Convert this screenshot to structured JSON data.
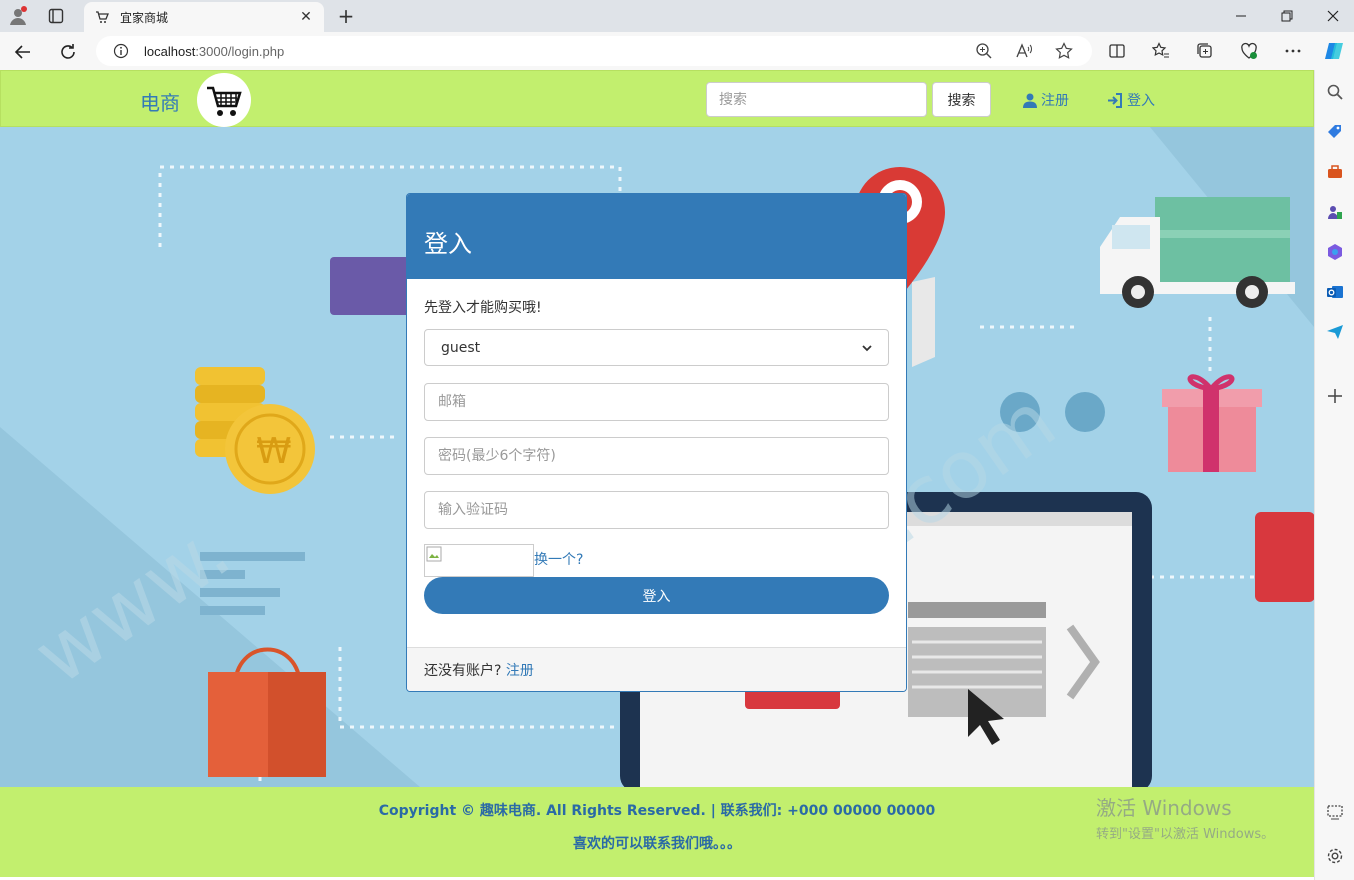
{
  "browser": {
    "tab_title": "宜家商城",
    "url_host": "localhost",
    "url_path": ":3000/login.php"
  },
  "navbar": {
    "brand": "电商",
    "search_placeholder": "搜索",
    "search_button": "搜索",
    "register": "注册",
    "login": "登入"
  },
  "login_panel": {
    "heading": "登入",
    "hint": "先登入才能购买哦!",
    "role_selected": "guest",
    "email_placeholder": "邮箱",
    "password_placeholder": "密码(最少6个字符)",
    "captcha_placeholder": "输入验证码",
    "refresh_captcha": "换一个?",
    "submit": "登入",
    "no_account": "还没有账户?",
    "register_link": "注册"
  },
  "footer": {
    "copyright": "Copyright © 趣味电商. All Rights Reserved. | 联系我们: +000 00000 00000",
    "slogan": "喜欢的可以联系我们哦。。。"
  },
  "watermark": {
    "line1": "激活 Windows",
    "line2": "转到\"设置\"以激活 Windows。"
  },
  "colors": {
    "primary": "#337ab7",
    "navbar_bg": "#c2ef6e",
    "hero_bg": "#a3d2e8"
  }
}
